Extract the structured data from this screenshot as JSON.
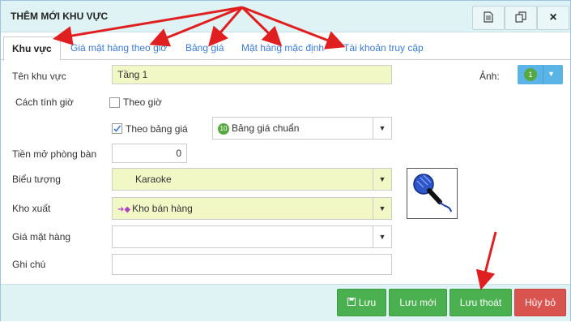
{
  "dialog": {
    "title": "THÊM MỚI KHU VỰC",
    "header_buttons": [
      {
        "icon": "document-icon"
      },
      {
        "icon": "copy-icon"
      },
      {
        "icon": "close-icon",
        "label": "×"
      }
    ]
  },
  "tabs": [
    {
      "label": "Khu vực",
      "active": true
    },
    {
      "label": "Giá mặt hàng theo giờ"
    },
    {
      "label": "Bảng giá"
    },
    {
      "label": "Mặt hàng mặc định"
    },
    {
      "label": "Tài khoản truy cập"
    }
  ],
  "form": {
    "ten_khu_vuc": {
      "label": "Tên khu vực",
      "value": "Tầng 1"
    },
    "anh": {
      "label": "Ảnh:",
      "badge": "1"
    },
    "cach_tinh_gio": {
      "label": "Cách tính giờ"
    },
    "theo_gio": {
      "label": "Theo giờ",
      "checked": false
    },
    "theo_bang_gia": {
      "label": "Theo bảng giá",
      "checked": true
    },
    "bang_gia": {
      "value": "Bảng giá chuẩn",
      "badge": "10"
    },
    "tien_mo_phong_ban": {
      "label": "Tiền mở phòng bàn",
      "value": "0"
    },
    "bieu_tuong": {
      "label": "Biểu tượng",
      "value": "Karaoke"
    },
    "kho_xuat": {
      "label": "Kho xuất",
      "value": "Kho bán hàng"
    },
    "gia_mat_hang": {
      "label": "Giá mặt hàng",
      "value": ""
    },
    "ghi_chu": {
      "label": "Ghi chú",
      "value": ""
    }
  },
  "footer": {
    "luu": "Lưu",
    "luu_moi": "Lưu mới",
    "luu_thoat": "Lưu thoát",
    "huy_bo": "Hủy bỏ"
  },
  "colors": {
    "header_bg": "#dff2f4",
    "field_yellow": "#f2f7c6",
    "tab_link": "#3a7bd5",
    "button_green": "#4bb04f",
    "button_red": "#d9534f",
    "annotation_arrow": "#e02020"
  }
}
